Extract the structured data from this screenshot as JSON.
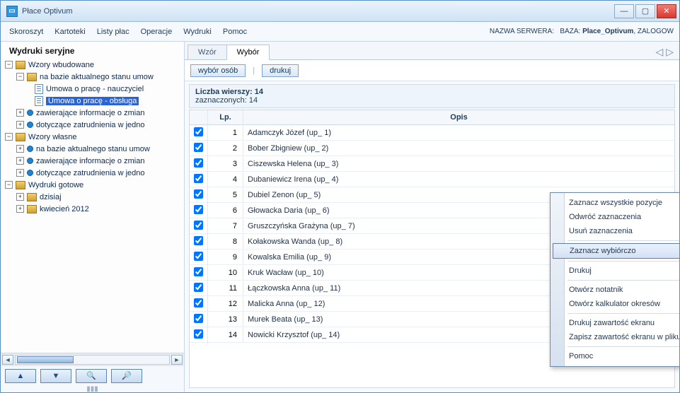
{
  "window": {
    "title": "Płace Optivum"
  },
  "menu": {
    "items": [
      "Skoroszyt",
      "Kartoteki",
      "Listy płac",
      "Operacje",
      "Wydruki",
      "Pomoc"
    ],
    "status_prefix": "NAZWA SERWERA:",
    "status_label_baza": "BAZA:",
    "status_db": "Place_Optivum",
    "status_suffix": ", ZALOGOW"
  },
  "sidebar": {
    "title": "Wydruki seryjne",
    "tree": {
      "n_wb": "Wzory wbudowane",
      "n_ba": "na bazie aktualnego stanu umow",
      "n_naucz": "Umowa o pracę - nauczyciel",
      "n_obsluga": "Umowa o pracę - obsługa",
      "n_zaw": "zawierające informacje o zmian",
      "n_dot": "dotyczące zatrudnienia w jedno",
      "n_ww": "Wzory własne",
      "n_ba2": "na bazie aktualnego stanu umow",
      "n_zaw2": "zawierające informacje o zmian",
      "n_dot2": "dotyczące zatrudnienia w jedno",
      "n_wg": "Wydruki gotowe",
      "n_dzis": "dzisiaj",
      "n_kwi": "kwiecień 2012"
    }
  },
  "tabs": {
    "t1": "Wzór",
    "t2": "Wybór"
  },
  "toolbar": {
    "b1": "wybór osób",
    "b2": "drukuj"
  },
  "info": {
    "line1_label": "Liczba wierszy:",
    "line1_value": "14",
    "line2_label": "zaznaczonych:",
    "line2_value": "14"
  },
  "grid": {
    "h_lp": "Lp.",
    "h_op": "Opis",
    "rows": [
      {
        "lp": "1",
        "opis": "Adamczyk Józef (up_ 1)"
      },
      {
        "lp": "2",
        "opis": "Bober Zbigniew (up_ 2)"
      },
      {
        "lp": "3",
        "opis": "Ciszewska Helena (up_ 3)"
      },
      {
        "lp": "4",
        "opis": "Dubaniewicz Irena (up_ 4)"
      },
      {
        "lp": "5",
        "opis": "Dubiel Zenon (up_ 5)"
      },
      {
        "lp": "6",
        "opis": "Głowacka Daria (up_ 6)"
      },
      {
        "lp": "7",
        "opis": "Gruszczyńska Grażyna (up_ 7)"
      },
      {
        "lp": "8",
        "opis": "Kołakowska Wanda (up_ 8)"
      },
      {
        "lp": "9",
        "opis": "Kowalska Emilia (up_ 9)"
      },
      {
        "lp": "10",
        "opis": "Kruk Wacław (up_ 10)"
      },
      {
        "lp": "11",
        "opis": "Łączkowska Anna (up_ 11)"
      },
      {
        "lp": "12",
        "opis": "Malicka Anna (up_ 12)"
      },
      {
        "lp": "13",
        "opis": "Murek Beata (up_ 13)"
      },
      {
        "lp": "14",
        "opis": "Nowicki Krzysztof (up_ 14)"
      }
    ]
  },
  "context": {
    "i1": "Zaznacz wszystkie pozycje",
    "i2": "Odwróć zaznaczenia",
    "i3": "Usuń zaznaczenia",
    "i4": "Zaznacz wybiórczo",
    "i5": "Drukuj",
    "i6": "Otwórz notatnik",
    "i7": "Otwórz kalkulator okresów",
    "i8": "Drukuj zawartość ekranu",
    "i9": "Zapisz zawartość ekranu w pliku",
    "i10": "Pomoc"
  }
}
